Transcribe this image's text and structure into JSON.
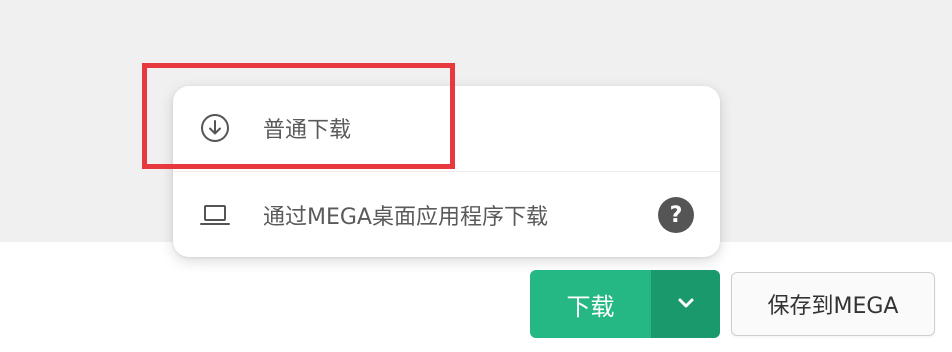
{
  "menu": {
    "items": [
      {
        "label": "普通下载",
        "icon": "download-circle-icon"
      },
      {
        "label": "通过MEGA桌面应用程序下载",
        "icon": "laptop-icon",
        "help_icon": "help-icon",
        "help_text": "?"
      }
    ]
  },
  "toolbar": {
    "download_label": "下载",
    "dropdown_icon": "chevron-down-icon",
    "save_label": "保存到MEGA"
  },
  "colors": {
    "accent": "#25b884",
    "accent_dark": "#1a9a6c",
    "highlight": "#e6383d"
  }
}
